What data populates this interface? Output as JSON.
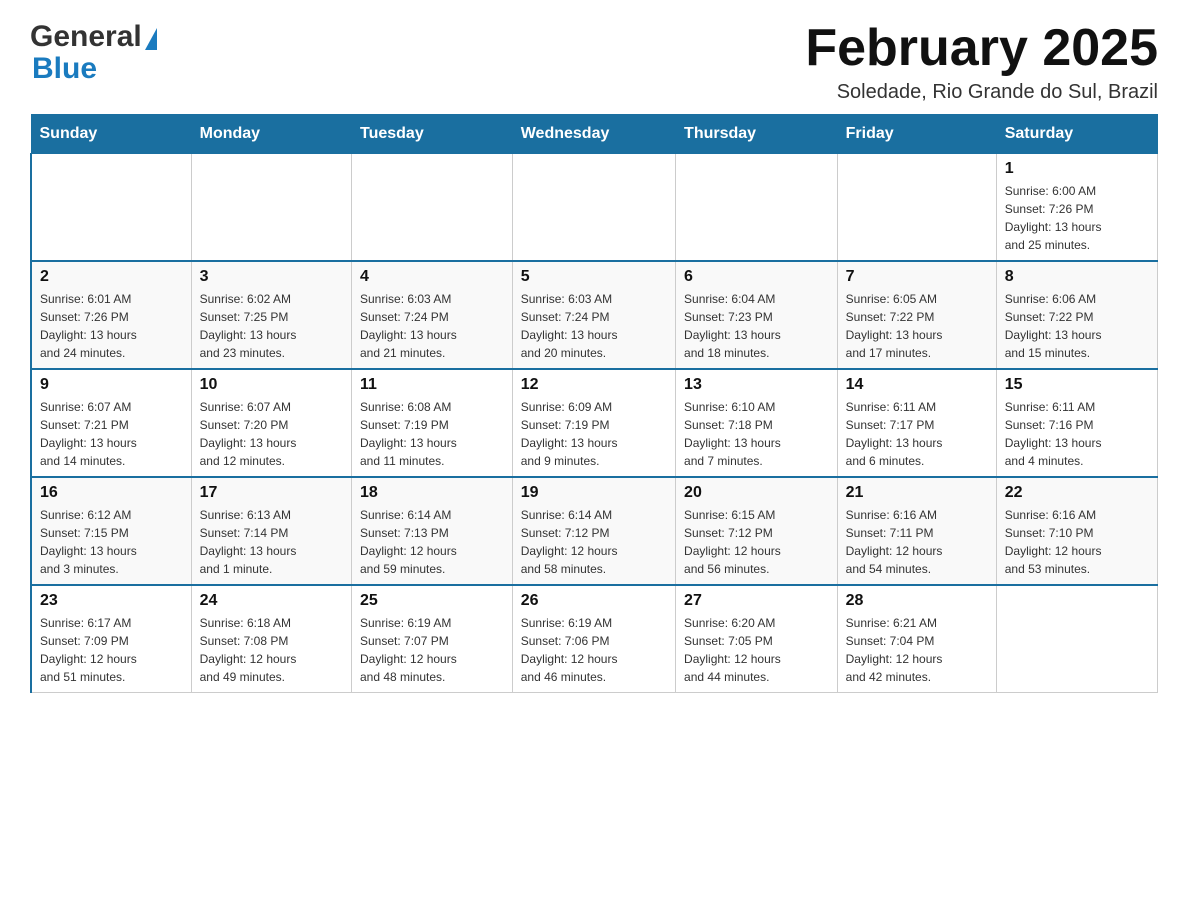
{
  "header": {
    "logo_general": "General",
    "logo_blue": "Blue",
    "month_title": "February 2025",
    "subtitle": "Soledade, Rio Grande do Sul, Brazil"
  },
  "weekdays": [
    "Sunday",
    "Monday",
    "Tuesday",
    "Wednesday",
    "Thursday",
    "Friday",
    "Saturday"
  ],
  "weeks": [
    [
      {
        "day": "",
        "info": ""
      },
      {
        "day": "",
        "info": ""
      },
      {
        "day": "",
        "info": ""
      },
      {
        "day": "",
        "info": ""
      },
      {
        "day": "",
        "info": ""
      },
      {
        "day": "",
        "info": ""
      },
      {
        "day": "1",
        "info": "Sunrise: 6:00 AM\nSunset: 7:26 PM\nDaylight: 13 hours\nand 25 minutes."
      }
    ],
    [
      {
        "day": "2",
        "info": "Sunrise: 6:01 AM\nSunset: 7:26 PM\nDaylight: 13 hours\nand 24 minutes."
      },
      {
        "day": "3",
        "info": "Sunrise: 6:02 AM\nSunset: 7:25 PM\nDaylight: 13 hours\nand 23 minutes."
      },
      {
        "day": "4",
        "info": "Sunrise: 6:03 AM\nSunset: 7:24 PM\nDaylight: 13 hours\nand 21 minutes."
      },
      {
        "day": "5",
        "info": "Sunrise: 6:03 AM\nSunset: 7:24 PM\nDaylight: 13 hours\nand 20 minutes."
      },
      {
        "day": "6",
        "info": "Sunrise: 6:04 AM\nSunset: 7:23 PM\nDaylight: 13 hours\nand 18 minutes."
      },
      {
        "day": "7",
        "info": "Sunrise: 6:05 AM\nSunset: 7:22 PM\nDaylight: 13 hours\nand 17 minutes."
      },
      {
        "day": "8",
        "info": "Sunrise: 6:06 AM\nSunset: 7:22 PM\nDaylight: 13 hours\nand 15 minutes."
      }
    ],
    [
      {
        "day": "9",
        "info": "Sunrise: 6:07 AM\nSunset: 7:21 PM\nDaylight: 13 hours\nand 14 minutes."
      },
      {
        "day": "10",
        "info": "Sunrise: 6:07 AM\nSunset: 7:20 PM\nDaylight: 13 hours\nand 12 minutes."
      },
      {
        "day": "11",
        "info": "Sunrise: 6:08 AM\nSunset: 7:19 PM\nDaylight: 13 hours\nand 11 minutes."
      },
      {
        "day": "12",
        "info": "Sunrise: 6:09 AM\nSunset: 7:19 PM\nDaylight: 13 hours\nand 9 minutes."
      },
      {
        "day": "13",
        "info": "Sunrise: 6:10 AM\nSunset: 7:18 PM\nDaylight: 13 hours\nand 7 minutes."
      },
      {
        "day": "14",
        "info": "Sunrise: 6:11 AM\nSunset: 7:17 PM\nDaylight: 13 hours\nand 6 minutes."
      },
      {
        "day": "15",
        "info": "Sunrise: 6:11 AM\nSunset: 7:16 PM\nDaylight: 13 hours\nand 4 minutes."
      }
    ],
    [
      {
        "day": "16",
        "info": "Sunrise: 6:12 AM\nSunset: 7:15 PM\nDaylight: 13 hours\nand 3 minutes."
      },
      {
        "day": "17",
        "info": "Sunrise: 6:13 AM\nSunset: 7:14 PM\nDaylight: 13 hours\nand 1 minute."
      },
      {
        "day": "18",
        "info": "Sunrise: 6:14 AM\nSunset: 7:13 PM\nDaylight: 12 hours\nand 59 minutes."
      },
      {
        "day": "19",
        "info": "Sunrise: 6:14 AM\nSunset: 7:12 PM\nDaylight: 12 hours\nand 58 minutes."
      },
      {
        "day": "20",
        "info": "Sunrise: 6:15 AM\nSunset: 7:12 PM\nDaylight: 12 hours\nand 56 minutes."
      },
      {
        "day": "21",
        "info": "Sunrise: 6:16 AM\nSunset: 7:11 PM\nDaylight: 12 hours\nand 54 minutes."
      },
      {
        "day": "22",
        "info": "Sunrise: 6:16 AM\nSunset: 7:10 PM\nDaylight: 12 hours\nand 53 minutes."
      }
    ],
    [
      {
        "day": "23",
        "info": "Sunrise: 6:17 AM\nSunset: 7:09 PM\nDaylight: 12 hours\nand 51 minutes."
      },
      {
        "day": "24",
        "info": "Sunrise: 6:18 AM\nSunset: 7:08 PM\nDaylight: 12 hours\nand 49 minutes."
      },
      {
        "day": "25",
        "info": "Sunrise: 6:19 AM\nSunset: 7:07 PM\nDaylight: 12 hours\nand 48 minutes."
      },
      {
        "day": "26",
        "info": "Sunrise: 6:19 AM\nSunset: 7:06 PM\nDaylight: 12 hours\nand 46 minutes."
      },
      {
        "day": "27",
        "info": "Sunrise: 6:20 AM\nSunset: 7:05 PM\nDaylight: 12 hours\nand 44 minutes."
      },
      {
        "day": "28",
        "info": "Sunrise: 6:21 AM\nSunset: 7:04 PM\nDaylight: 12 hours\nand 42 minutes."
      },
      {
        "day": "",
        "info": ""
      }
    ]
  ]
}
